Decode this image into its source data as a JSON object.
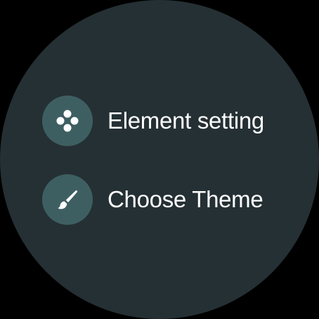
{
  "menu": {
    "items": [
      {
        "label": "Element setting",
        "icon": "four-dots-icon"
      },
      {
        "label": "Choose Theme",
        "icon": "paintbrush-icon"
      }
    ]
  },
  "colors": {
    "background": "#253034",
    "icon_circle": "#3e5f62",
    "text": "#ffffff"
  }
}
